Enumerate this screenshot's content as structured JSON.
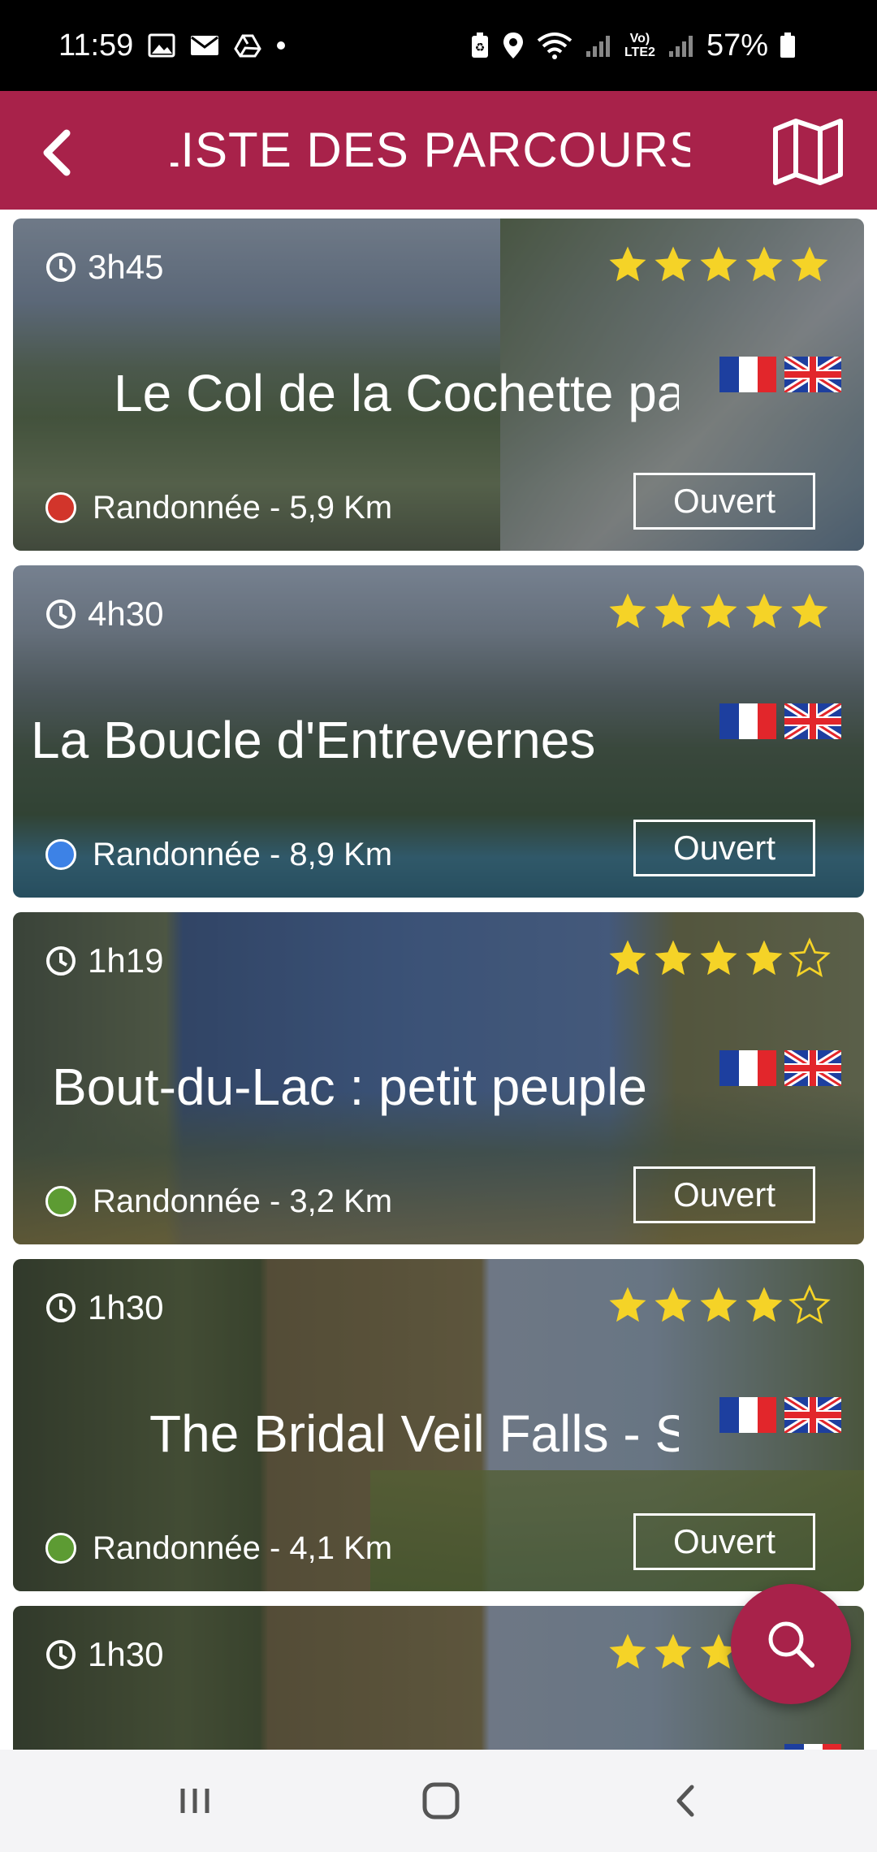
{
  "status_bar": {
    "time": "11:59",
    "battery": "57%",
    "network": "Vo) LTE2"
  },
  "app_bar": {
    "title": "LISTE DES PARCOURS"
  },
  "colors": {
    "brand": "#a8224a",
    "star": "#f5d327",
    "red_dot": "#d2352b",
    "blue_dot": "#3d82e6",
    "green_dot": "#5d9b33"
  },
  "routes": [
    {
      "duration": "3h45",
      "rating": 5,
      "title": "Le Col de la Cochette par",
      "type": "Randonnée - 5,9 Km",
      "status": "Ouvert",
      "difficulty_color": "#d2352b",
      "languages": [
        "fr-flag-icon",
        "uk-flag-icon"
      ]
    },
    {
      "duration": "4h30",
      "rating": 5,
      "title": "La Boucle d'Entrevernes",
      "type": "Randonnée - 8,9 Km",
      "status": "Ouvert",
      "difficulty_color": "#3d82e6",
      "languages": [
        "fr-flag-icon",
        "uk-flag-icon"
      ]
    },
    {
      "duration": "1h19",
      "rating": 4,
      "title": "Bout-du-Lac : petit peuple",
      "type": "Randonnée - 3,2 Km",
      "status": "Ouvert",
      "difficulty_color": "#5d9b33",
      "languages": [
        "fr-flag-icon",
        "uk-flag-icon"
      ]
    },
    {
      "duration": "1h30",
      "rating": 4,
      "title": "The Bridal Veil Falls - S",
      "type": "Randonnée - 4,1 Km",
      "status": "Ouvert",
      "difficulty_color": "#5d9b33",
      "languages": [
        "fr-flag-icon",
        "uk-flag-icon"
      ]
    },
    {
      "duration": "1h30",
      "rating": 4,
      "title": "",
      "type": "",
      "status": "",
      "difficulty_color": "#5d9b33",
      "languages": [
        "fr-flag-icon"
      ]
    }
  ],
  "icons": {
    "back": "chevron-left-icon",
    "map": "map-icon",
    "search": "search-icon",
    "clock": "clock-icon"
  }
}
